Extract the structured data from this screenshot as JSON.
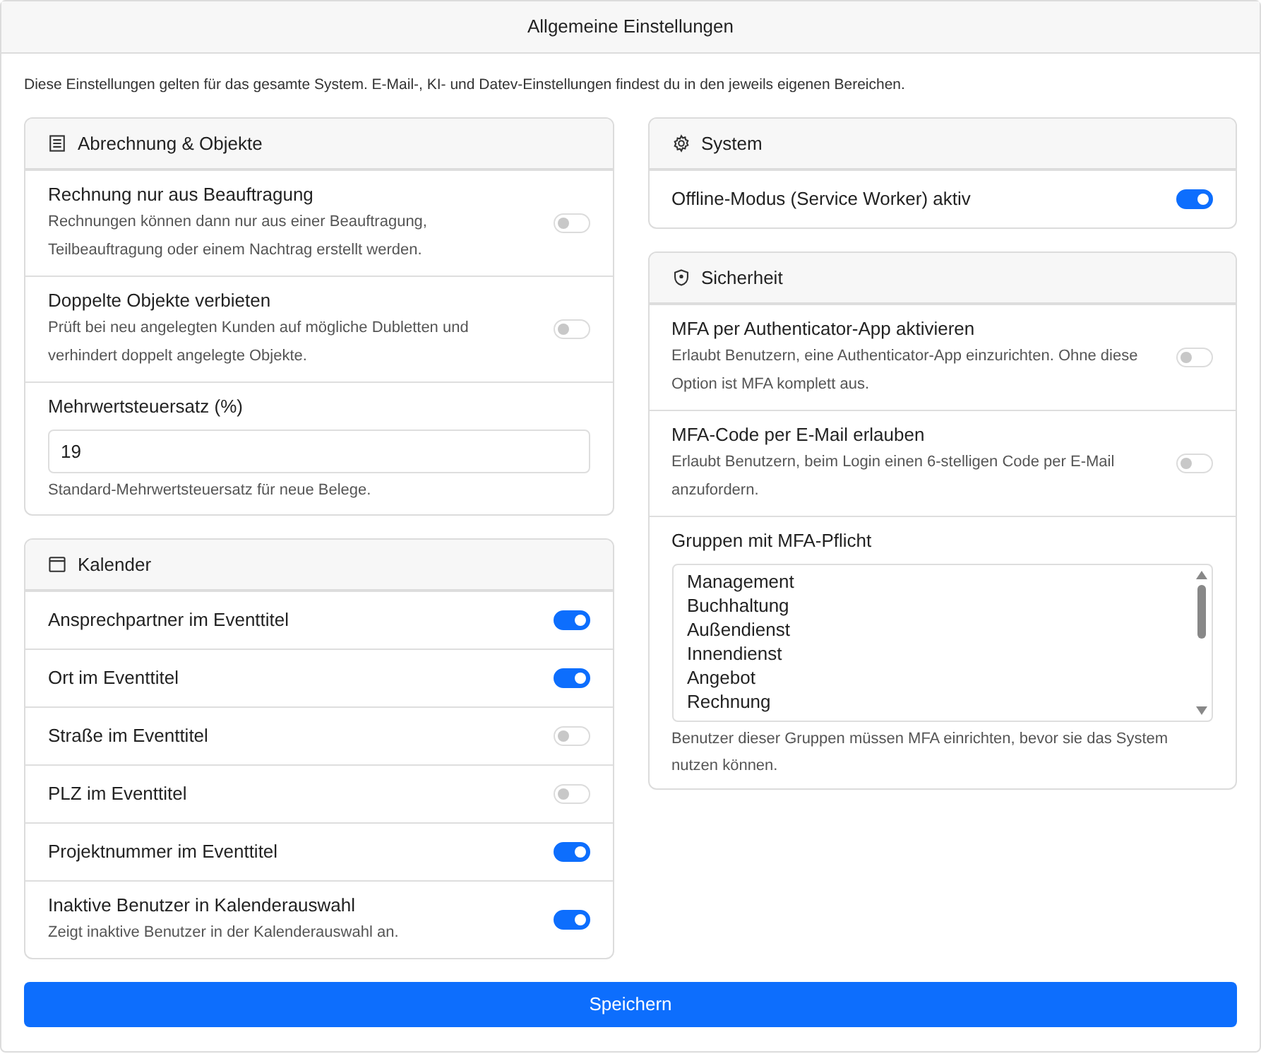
{
  "header": {
    "title": "Allgemeine Einstellungen"
  },
  "intro": "Diese Einstellungen gelten für das gesamte System. E-Mail-, KI- und Datev-Einstellungen findest du in den jeweils eigenen Bereichen.",
  "columns": [
    {
      "sections": [
        {
          "title": "Abrechnung & Objekte",
          "items": [
            {
              "kind": "toggle",
              "label": "Rechnung nur aus Beauftragung",
              "description": "Rechnungen können dann nur aus einer Beauftragung, Teilbeauftragung oder einem Nachtrag erstellt werden.",
              "on": false
            },
            {
              "kind": "toggle",
              "label": "Doppelte Objekte verbieten",
              "description": "Prüft bei neu angelegten Kunden auf mögliche Dubletten und verhindert doppelt angelegte Objekte.",
              "on": false
            },
            {
              "kind": "number",
              "label": "Mehrwertsteuersatz (%)",
              "value": "19",
              "description": "Standard-Mehrwertsteuersatz für neue Belege."
            }
          ]
        },
        {
          "title": "Kalender",
          "items": [
            {
              "kind": "toggle",
              "label": "Ansprechpartner im Eventtitel",
              "on": true
            },
            {
              "kind": "toggle",
              "label": "Ort im Eventtitel",
              "on": true
            },
            {
              "kind": "toggle",
              "label": "Straße im Eventtitel",
              "on": false
            },
            {
              "kind": "toggle",
              "label": "PLZ im Eventtitel",
              "on": false
            },
            {
              "kind": "toggle",
              "label": "Projektnummer im Eventtitel",
              "on": true
            },
            {
              "kind": "toggle",
              "label": "Inaktive Benutzer in Kalenderauswahl",
              "description": "Zeigt inaktive Benutzer in der Kalenderauswahl an.",
              "on": true
            }
          ]
        }
      ]
    },
    {
      "sections": [
        {
          "title": "System",
          "items": [
            {
              "kind": "toggle",
              "label": "Offline-Modus (Service Worker) aktiv",
              "on": true
            }
          ]
        },
        {
          "title": "Sicherheit",
          "items": [
            {
              "kind": "toggle",
              "label": "MFA per Authenticator-App aktivieren",
              "description": "Erlaubt Benutzern, eine Authenticator-App einzurichten. Ohne diese Option ist MFA komplett aus.",
              "on": false
            },
            {
              "kind": "toggle",
              "label": "MFA-Code per E-Mail erlauben",
              "description": "Erlaubt Benutzern, beim Login einen 6-stelligen Code per E-Mail anzufordern.",
              "on": false
            },
            {
              "kind": "listbox",
              "label": "Gruppen mit MFA-Pflicht",
              "options": [
                "Management",
                "Buchhaltung",
                "Außendienst",
                "Innendienst",
                "Angebot",
                "Rechnung"
              ],
              "description": "Benutzer dieser Gruppen müssen MFA einrichten, bevor sie das System nutzen können."
            }
          ]
        }
      ]
    }
  ],
  "save_button": "Speichern"
}
